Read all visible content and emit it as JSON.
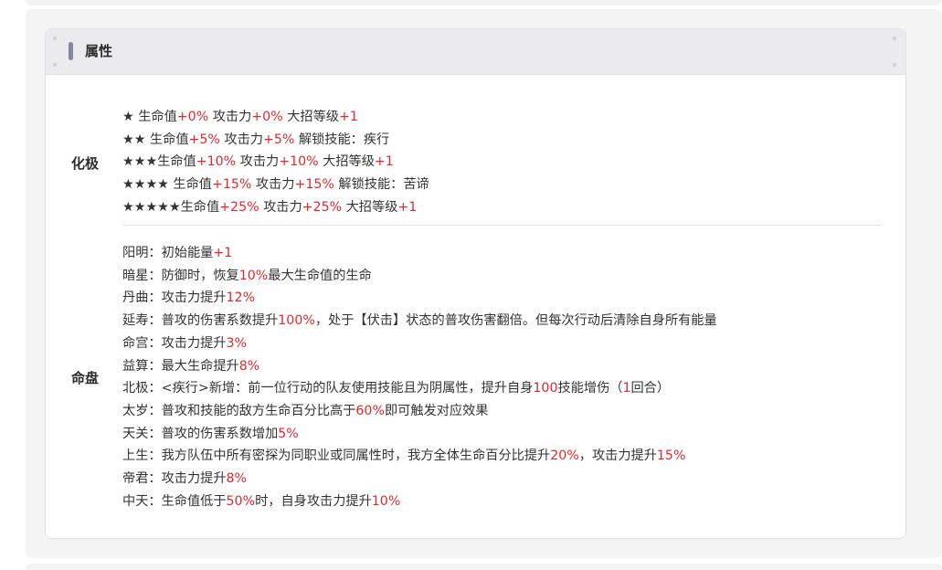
{
  "header": {
    "title": "属性"
  },
  "ascension": {
    "label": "化极",
    "lines": [
      [
        {
          "t": "★ 生命值"
        },
        {
          "t": "+0%",
          "hl": true
        },
        {
          "t": " 攻击力"
        },
        {
          "t": "+0%",
          "hl": true
        },
        {
          "t": " 大招等级"
        },
        {
          "t": "+1",
          "hl": true
        }
      ],
      [
        {
          "t": "★★ 生命值"
        },
        {
          "t": "+5%",
          "hl": true
        },
        {
          "t": " 攻击力"
        },
        {
          "t": "+5%",
          "hl": true
        },
        {
          "t": " 解锁技能：疾行"
        }
      ],
      [
        {
          "t": "★★★生命值"
        },
        {
          "t": "+10%",
          "hl": true
        },
        {
          "t": " 攻击力"
        },
        {
          "t": "+10%",
          "hl": true
        },
        {
          "t": " 大招等级"
        },
        {
          "t": "+1",
          "hl": true
        }
      ],
      [
        {
          "t": "★★★★ 生命值"
        },
        {
          "t": "+15%",
          "hl": true
        },
        {
          "t": " 攻击力"
        },
        {
          "t": "+15%",
          "hl": true
        },
        {
          "t": " 解锁技能：苦谛"
        }
      ],
      [
        {
          "t": "★★★★★生命值"
        },
        {
          "t": "+25%",
          "hl": true
        },
        {
          "t": " 攻击力"
        },
        {
          "t": "+25%",
          "hl": true
        },
        {
          "t": " 大招等级"
        },
        {
          "t": "+1",
          "hl": true
        }
      ]
    ]
  },
  "astrolabe": {
    "label": "命盘",
    "lines": [
      [
        {
          "t": "阳明：初始能量"
        },
        {
          "t": "+1",
          "hl": true
        }
      ],
      [
        {
          "t": "暗星：防御时，恢复"
        },
        {
          "t": "10%",
          "hl": true
        },
        {
          "t": "最大生命值的生命"
        }
      ],
      [
        {
          "t": "丹曲：攻击力提升"
        },
        {
          "t": "12%",
          "hl": true
        }
      ],
      [
        {
          "t": "延寿：普攻的伤害系数提升"
        },
        {
          "t": "100%",
          "hl": true
        },
        {
          "t": "，处于【伏击】状态的普攻伤害翻倍。但每次行动后清除自身所有能量"
        }
      ],
      [
        {
          "t": "命宫：攻击力提升"
        },
        {
          "t": "3%",
          "hl": true
        }
      ],
      [
        {
          "t": "益算：最大生命提升"
        },
        {
          "t": "8%",
          "hl": true
        }
      ],
      [
        {
          "t": "北极：<疾行>新增：前一位行动的队友使用技能且为阴属性，提升自身"
        },
        {
          "t": "100",
          "hl": true
        },
        {
          "t": "技能增伤（"
        },
        {
          "t": "1",
          "hl": true
        },
        {
          "t": "回合）"
        }
      ],
      [
        {
          "t": "太岁：普攻和技能的敌方生命百分比高于"
        },
        {
          "t": "60%",
          "hl": true
        },
        {
          "t": "即可触发对应效果"
        }
      ],
      [
        {
          "t": "天关：普攻的伤害系数增加"
        },
        {
          "t": "5%",
          "hl": true
        }
      ],
      [
        {
          "t": "上生：我方队伍中所有密探为同职业或同属性时，我方全体生命百分比提升"
        },
        {
          "t": "20%",
          "hl": true
        },
        {
          "t": "，攻击力提升"
        },
        {
          "t": "15%",
          "hl": true
        }
      ],
      [
        {
          "t": "帝君：攻击力提升"
        },
        {
          "t": "8%",
          "hl": true
        }
      ],
      [
        {
          "t": "中天：生命值低于"
        },
        {
          "t": "50%",
          "hl": true
        },
        {
          "t": "时，自身攻击力提升"
        },
        {
          "t": "10%",
          "hl": true
        }
      ]
    ]
  },
  "colors": {
    "highlight": "#e0282d",
    "accent_bar": "#7f86a6"
  }
}
